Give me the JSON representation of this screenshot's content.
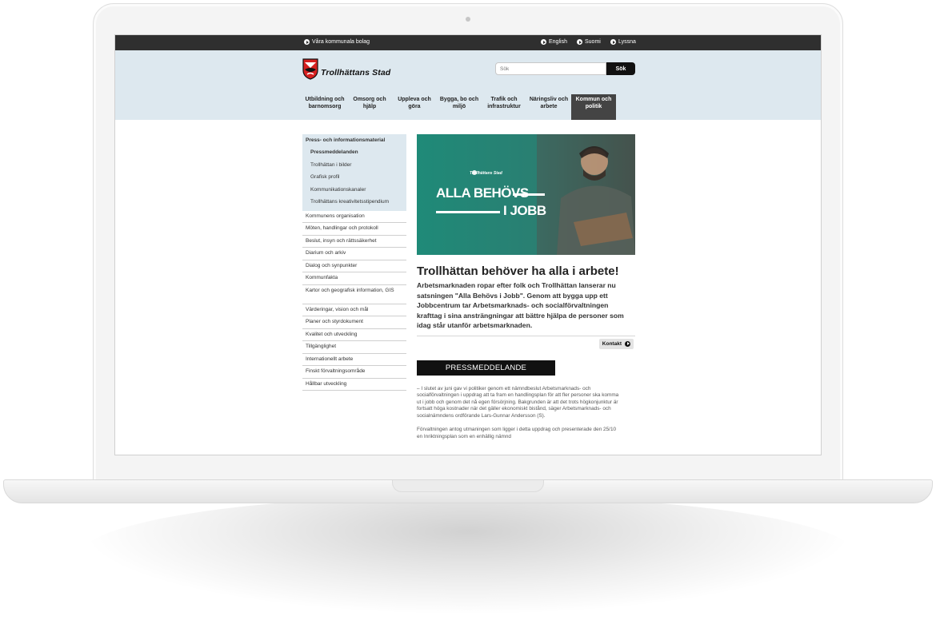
{
  "topbar": {
    "companies": "Våra kommunala bolag",
    "english": "English",
    "suomi": "Suomi",
    "lyssna": "Lyssna"
  },
  "header": {
    "logo_text": "Trollhättans Stad",
    "search_placeholder": "Sök",
    "search_button": "Sök"
  },
  "nav": [
    {
      "label": "Utbildning och barnomsorg"
    },
    {
      "label": "Omsorg och hjälp"
    },
    {
      "label": "Uppleva och göra"
    },
    {
      "label": "Bygga, bo och miljö"
    },
    {
      "label": "Trafik och infrastruktur"
    },
    {
      "label": "Näringsliv och arbete"
    },
    {
      "label": "Kommun och politik",
      "active": true
    }
  ],
  "sidebar": {
    "section_title": "Press- och informationsmaterial",
    "sub_items": [
      "Pressmeddelanden",
      "Trollhättan i bilder",
      "Grafisk profil",
      "Kommunikationskanaler",
      "Trollhättans kreativitetsstipendium"
    ],
    "links": [
      "Kommunens organisation",
      "Möten, handlingar och protokoll",
      "Beslut, insyn och rättssäkerhet",
      "Diarium och arkiv",
      "Dialog och synpunkter",
      "Kommunfakta",
      "Kartor och geografisk information, GIS",
      "Värderingar, vision och mål",
      "Planer och styrdokument",
      "Kvalitet och utveckling",
      "Tillgänglighet",
      "Internationellt arbete",
      "Finskt förvaltningsområde",
      "Hållbar utveckling"
    ]
  },
  "hero": {
    "logo_text": "Trollhättans Stad",
    "line1": "ALLA BEHÖVS",
    "line2": "I JOBB"
  },
  "article": {
    "title": "Trollhättan behöver ha alla i arbete!",
    "lead": "Arbetsmarknaden ropar efter folk och Trollhättan lanserar nu satsningen \"Alla Behövs i Jobb\". Genom att bygga upp ett Jobbcentrum tar Arbetsmarknads- och socialförvaltningen krafttag i sina ansträngningar att bättre hjälpa de personer som idag står utanför arbetsmarknaden.",
    "contact_button": "Kontakt",
    "badge": "PRESSMEDDELANDE",
    "paragraph1": "– I slutet av juni gav vi politiker genom ett nämndbeslut Arbetsmarknads- och socialförvaltningen i uppdrag att ta fram en handlingsplan för att fler personer ska komma ut i jobb och genom det nå egen försörjning. Bakgrunden är att det trots högkonjunktur är fortsatt höga kostnader när det gäller ekonomiskt bistånd, säger Arbetsmarknads- och socialnämndens ordförande Lars-Gunnar Andersson (S).",
    "paragraph2": "Förvaltningen antog utmaningen som ligger i detta uppdrag och presenterade den 25/10 en Inriktningsplan som en enhällig nämnd"
  },
  "colors": {
    "topbar": "#2f2f2f",
    "header_bg": "#dde8ef",
    "active_tab": "#444444",
    "hero_green": "#2a7f72"
  }
}
